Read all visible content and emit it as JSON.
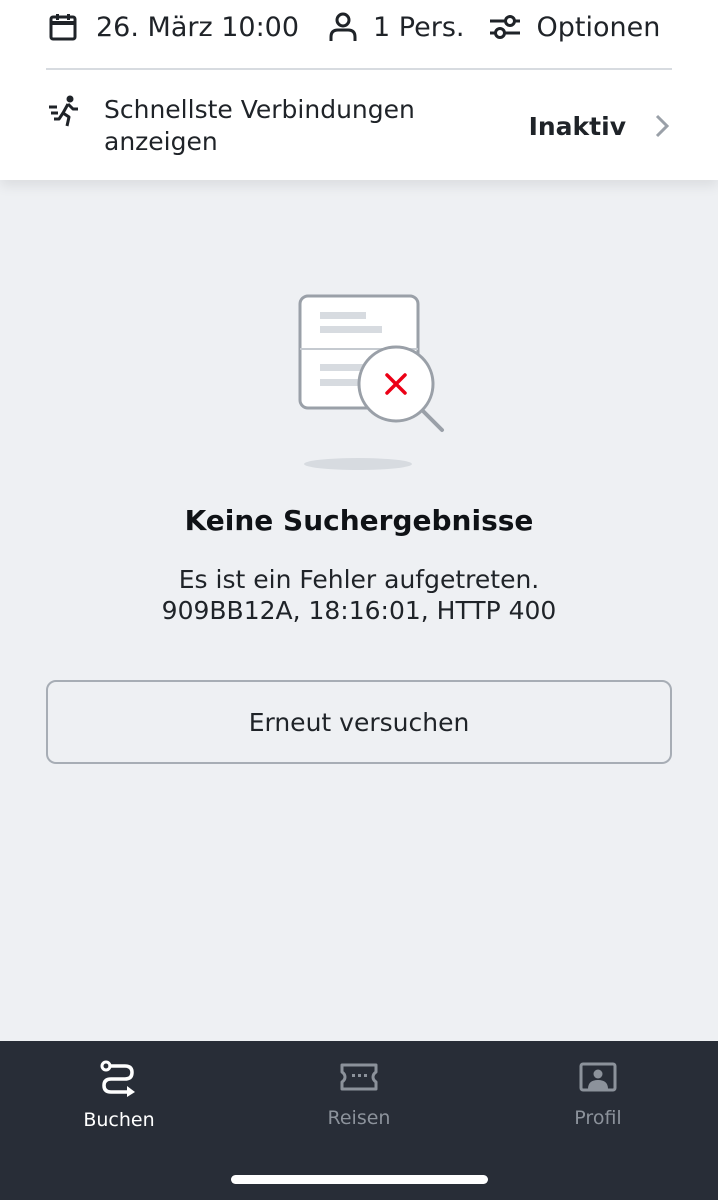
{
  "options_bar": {
    "date_time": "26. März 10:00",
    "persons": "1 Pers.",
    "options": "Optionen"
  },
  "fastest_connections": {
    "label": "Schnellste Verbindungen anzeigen",
    "status": "Inaktiv"
  },
  "empty_state": {
    "title": "Keine Suchergebnisse",
    "message_line1": "Es ist ein Fehler aufgetreten.",
    "message_line2": "909BB12A, 18:16:01, HTTP 400",
    "retry_label": "Erneut versuchen"
  },
  "bottom_nav": {
    "items": [
      {
        "label": "Buchen",
        "icon": "route-icon",
        "active": true
      },
      {
        "label": "Reisen",
        "icon": "ticket-icon",
        "active": false
      },
      {
        "label": "Profil",
        "icon": "profile-card-icon",
        "active": false
      }
    ]
  },
  "colors": {
    "background": "#eef0f3",
    "card": "#ffffff",
    "nav_background": "#282d37",
    "error_red": "#ec0016",
    "inactive_nav": "#8c929b"
  }
}
